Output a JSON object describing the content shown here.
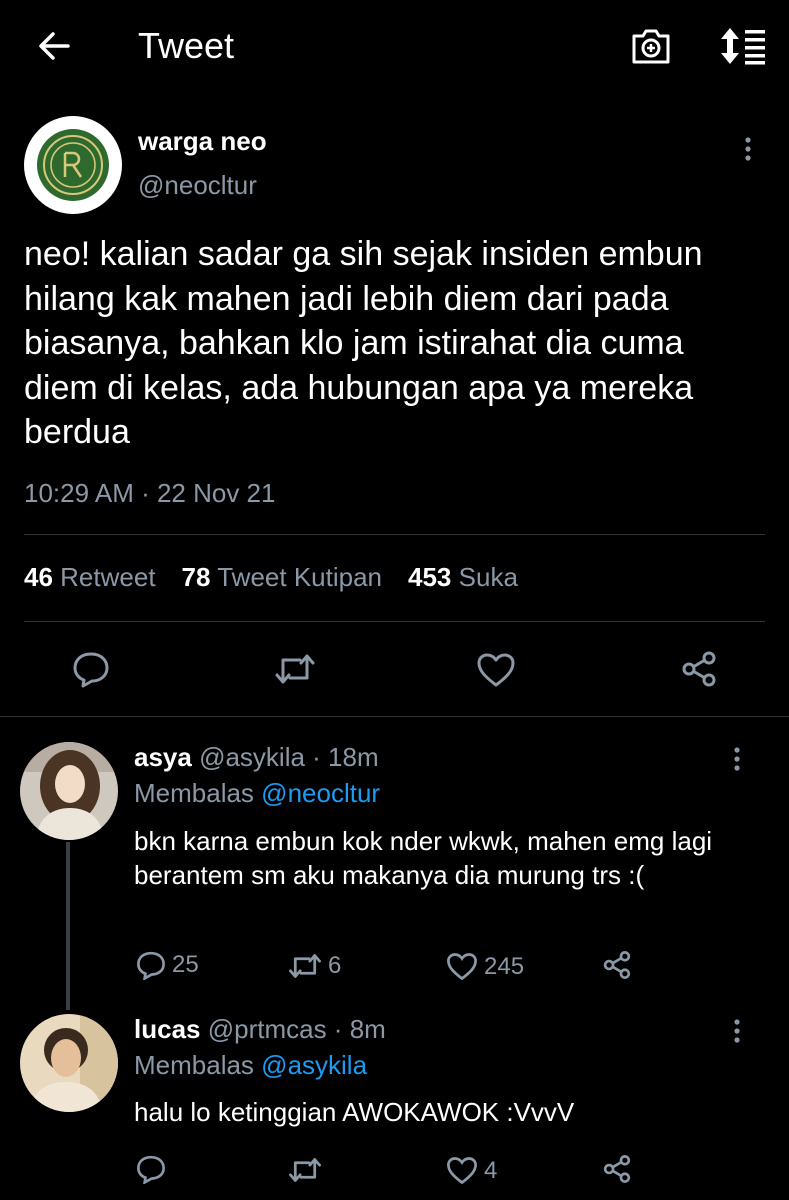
{
  "header": {
    "title": "Tweet",
    "icons": [
      "back-arrow-icon",
      "camera-add-icon",
      "sort-icon"
    ]
  },
  "main_tweet": {
    "display_name": "warga neo",
    "handle": "@neocltur",
    "text": "neo! kalian sadar ga sih sejak insiden embun hilang kak mahen jadi lebih diem dari pada biasanya, bahkan klo jam istirahat dia cuma diem di kelas, ada hubungan apa ya mereka berdua",
    "timestamp": "10:29 AM · 22 Nov 21",
    "stats": [
      {
        "count": "46",
        "label": "Retweet"
      },
      {
        "count": "78",
        "label": "Tweet Kutipan"
      },
      {
        "count": "453",
        "label": "Suka"
      }
    ]
  },
  "replies": [
    {
      "display_name": "asya",
      "meta": "@asykila · 18m",
      "reply_prefix": "Membalas",
      "reply_to": "@neocltur",
      "text": "bkn karna embun kok nder wkwk, mahen emg lagi berantem sm aku makanya dia murung trs :(",
      "replies": "25",
      "retweets": "6",
      "likes": "245"
    },
    {
      "display_name": "lucas",
      "meta": "@prtmcas · 8m",
      "reply_prefix": "Membalas",
      "reply_to": "@asykila",
      "text": "halu lo ketinggian AWOKAWOK :VvvV",
      "replies": "",
      "retweets": "",
      "likes": "4"
    }
  ],
  "colors": {
    "background": "#000000",
    "text": "#ffffff",
    "secondary": "#8b98a5",
    "link": "#1d9bf0",
    "divider": "#2f3336"
  }
}
